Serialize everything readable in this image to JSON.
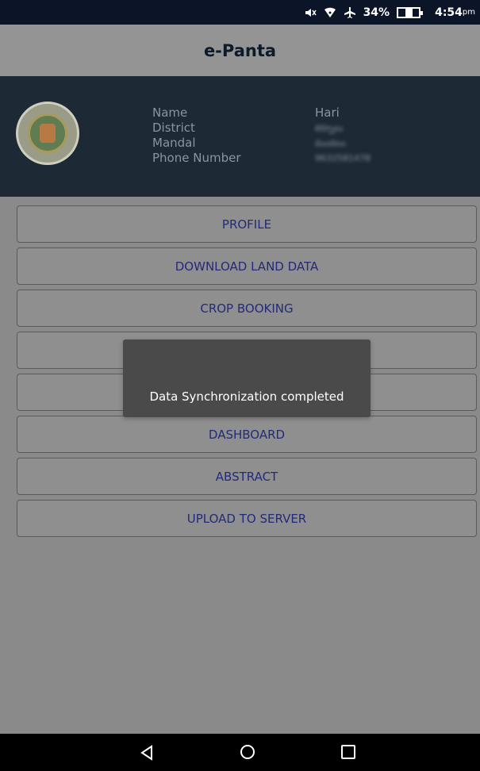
{
  "status_bar": {
    "icons": [
      "mute-icon",
      "wifi-icon",
      "airplane-icon"
    ],
    "battery_percent": "34%",
    "battery_level": 0.34,
    "time": "4:54",
    "time_suffix": "pm"
  },
  "app": {
    "title": "e-Panta"
  },
  "profile": {
    "labels": [
      "Name",
      "District",
      "Mandal",
      "Phone Number"
    ],
    "values": [
      "Hari",
      "కర్నూలు",
      "మండలం",
      "9632581478"
    ]
  },
  "menu": [
    "PROFILE",
    "DOWNLOAD LAND DATA",
    "CROP BOOKING",
    "",
    "",
    "DASHBOARD",
    "ABSTRACT",
    "UPLOAD TO SERVER"
  ],
  "toast": {
    "message": "Data Synchronization completed"
  },
  "colors": {
    "status_bar": "#0c1428",
    "info_panel": "#1d2935",
    "button_text": "#232a7a",
    "toast_bg": "#4a4a4a"
  }
}
